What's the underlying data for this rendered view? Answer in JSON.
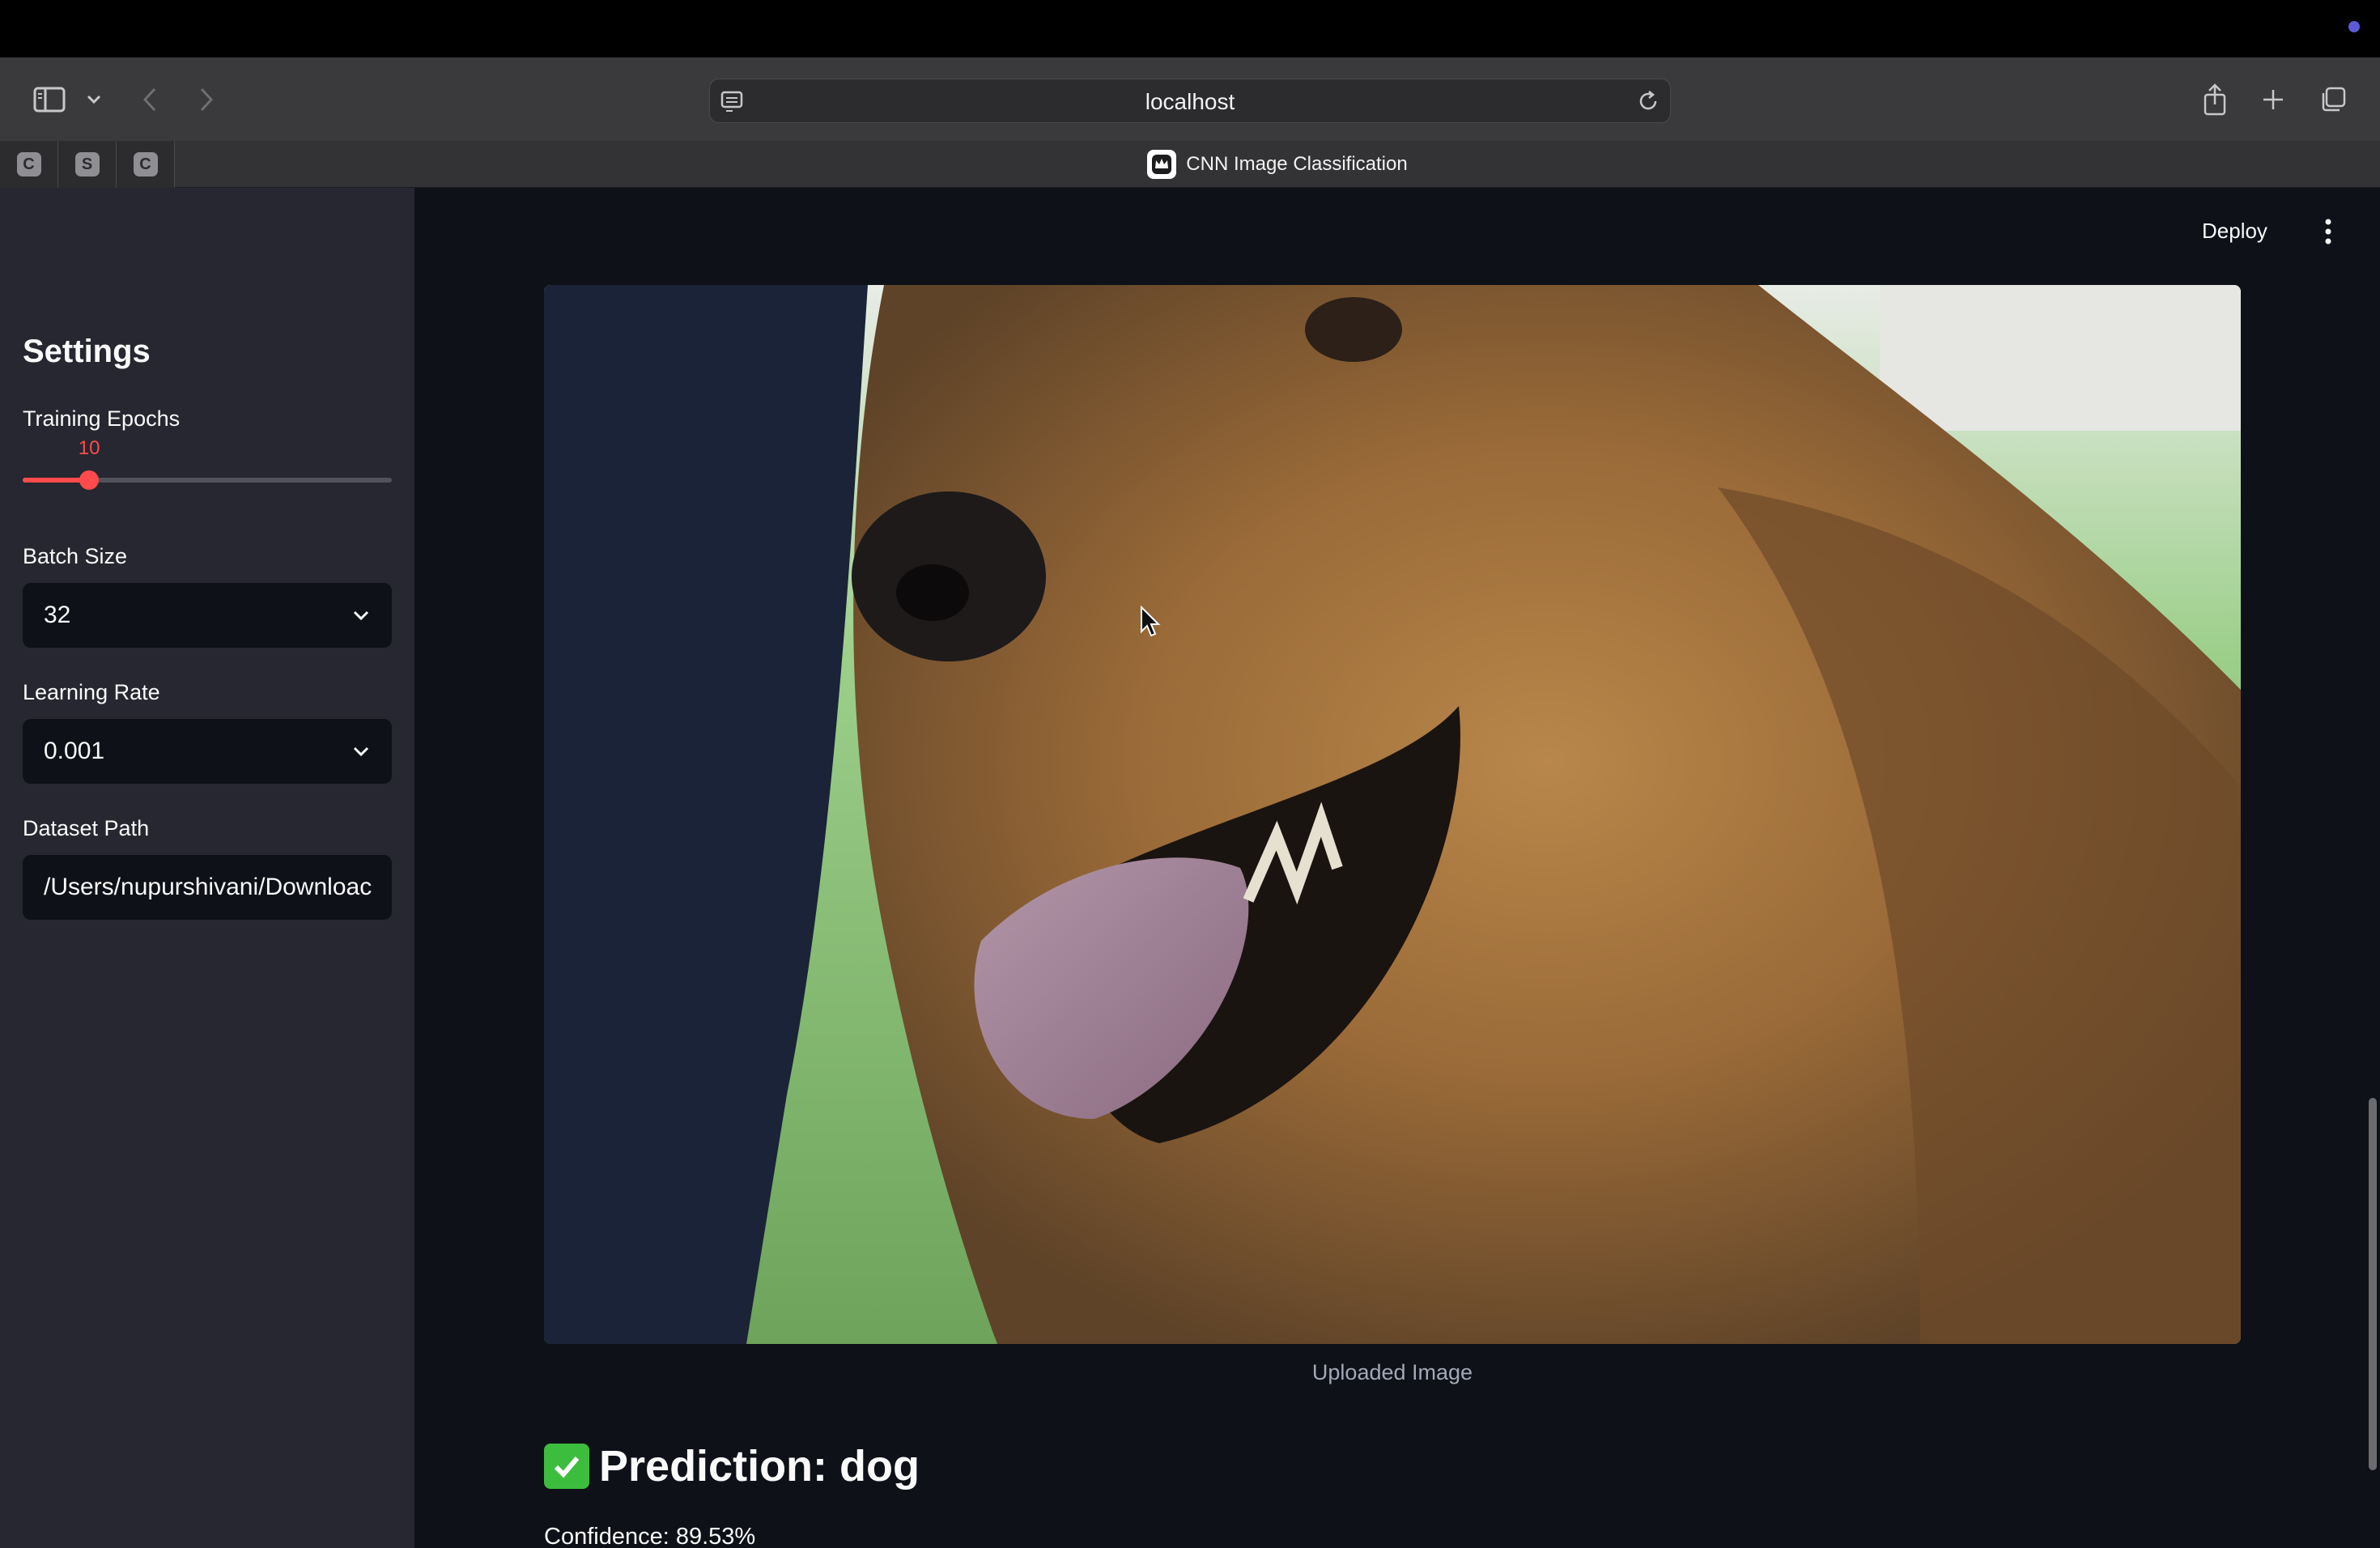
{
  "browser": {
    "url": "localhost",
    "pinned_tabs": [
      "C",
      "S",
      "C"
    ],
    "active_tab_title": "CNN Image Classification"
  },
  "header": {
    "deploy_label": "Deploy"
  },
  "sidebar": {
    "title": "Settings",
    "epochs": {
      "label": "Training Epochs",
      "value": "10",
      "fraction": 0.18
    },
    "batch_size": {
      "label": "Batch Size",
      "value": "32"
    },
    "learning_rate": {
      "label": "Learning Rate",
      "value": "0.001"
    },
    "dataset_path": {
      "label": "Dataset Path",
      "value": "/Users/nupurshivani/Downloac"
    }
  },
  "main": {
    "image_caption": "Uploaded Image",
    "prediction": "Prediction: dog",
    "confidence": "Confidence: 89.53%"
  },
  "colors": {
    "accent": "#ff4b4b",
    "app_background": "#0e1117",
    "sidebar_background": "#262730",
    "success": "#3dbd3d"
  }
}
